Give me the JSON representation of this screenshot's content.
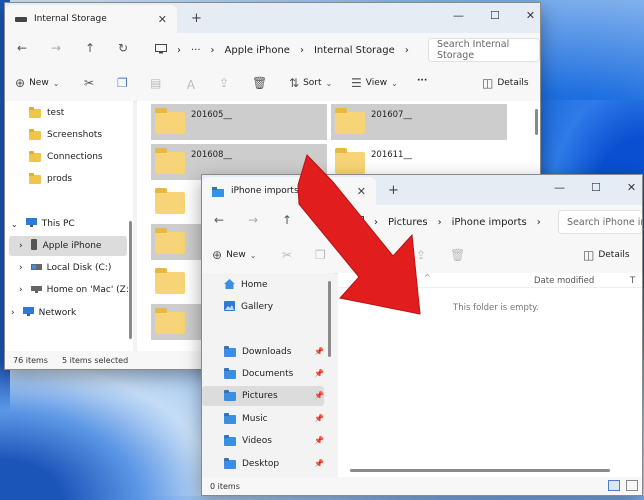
{
  "window1": {
    "tab_title": "Internal Storage",
    "breadcrumb": [
      "Apple iPhone",
      "Internal Storage"
    ],
    "search_placeholder": "Search Internal Storage",
    "toolbar": {
      "new": "New",
      "sort": "Sort",
      "view": "View",
      "details": "Details"
    },
    "nav_items": [
      {
        "label": "test",
        "type": "folder"
      },
      {
        "label": "Screenshots",
        "type": "folder"
      },
      {
        "label": "Connections",
        "type": "folder"
      },
      {
        "label": "prods",
        "type": "folder"
      },
      {
        "label": "This PC",
        "type": "pc"
      },
      {
        "label": "Apple iPhone",
        "type": "phone"
      },
      {
        "label": "Local Disk (C:)",
        "type": "disk"
      },
      {
        "label": "Home on 'Mac' (Z:)",
        "type": "disk"
      },
      {
        "label": "Network",
        "type": "network"
      }
    ],
    "folders": [
      "201605__",
      "201607__",
      "201608__",
      "201611__"
    ],
    "status": {
      "items": "76 items",
      "selected": "5 items selected"
    }
  },
  "window2": {
    "tab_title": "iPhone imports",
    "breadcrumb": [
      "Pictures",
      "iPhone imports"
    ],
    "search_placeholder": "Search iPhone imports",
    "toolbar": {
      "new": "New",
      "details": "Details"
    },
    "nav_items": [
      {
        "label": "Home",
        "type": "home"
      },
      {
        "label": "Gallery",
        "type": "gallery"
      },
      {
        "label": "Downloads",
        "type": "folder"
      },
      {
        "label": "Documents",
        "type": "folder"
      },
      {
        "label": "Pictures",
        "type": "folder"
      },
      {
        "label": "Music",
        "type": "folder"
      },
      {
        "label": "Videos",
        "type": "folder"
      },
      {
        "label": "Desktop",
        "type": "folder"
      }
    ],
    "column_date_modified": "Date modified",
    "column_type": "T",
    "empty_message": "This folder is empty.",
    "status": {
      "items": "0 items"
    }
  },
  "colors": {
    "arrow": "#e11d1d",
    "selection": "#cdcdcd",
    "accent": "#0067c0"
  }
}
